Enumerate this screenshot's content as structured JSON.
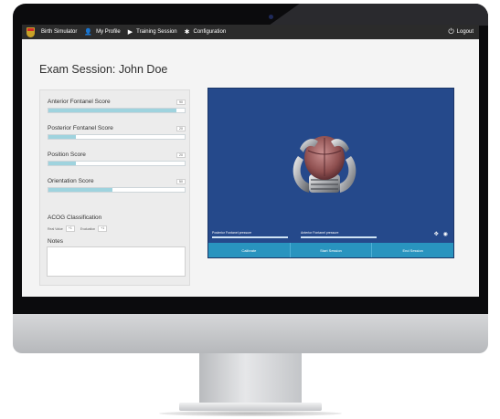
{
  "nav": {
    "items": [
      {
        "label": "Birth Simulator",
        "icon": "logo-shield"
      },
      {
        "label": "My Profile",
        "icon": "user-icon"
      },
      {
        "label": "Training Session",
        "icon": "play-icon"
      },
      {
        "label": "Configuration",
        "icon": "gear-icon"
      }
    ],
    "logout_label": "Logout",
    "logout_icon": "power-icon"
  },
  "page": {
    "title": "Exam Session: John Doe"
  },
  "scores": [
    {
      "label": "Anterior Fontanel Score",
      "value": "90",
      "fill": 0.94
    },
    {
      "label": "Posterior Fontanel Score",
      "value": "20",
      "fill": 0.2
    },
    {
      "label": "Position Score",
      "value": "20",
      "fill": 0.2
    },
    {
      "label": "Orientation Score",
      "value": "50",
      "fill": 0.47
    }
  ],
  "acog": {
    "title": "ACOG Classification",
    "real_label": "Real Value",
    "real_value": "+1",
    "eval_label": "Evaluation",
    "eval_value": "+1"
  },
  "notes": {
    "label": "Notes",
    "value": ""
  },
  "viewer": {
    "posterior_label": "Posterior Fontanel pressure",
    "posterior_fill": 0.85,
    "anterior_label": "Anterior Fontanel pressure",
    "anterior_fill": 0.85
  },
  "actions": {
    "calibrate": "Calibrate",
    "start": "Start Session",
    "end": "End Session"
  },
  "colors": {
    "topbar": "#2b2b2b",
    "viewer_bg": "#25498b",
    "accent": "#2994bf",
    "bar_fill": "#9fd3de"
  }
}
